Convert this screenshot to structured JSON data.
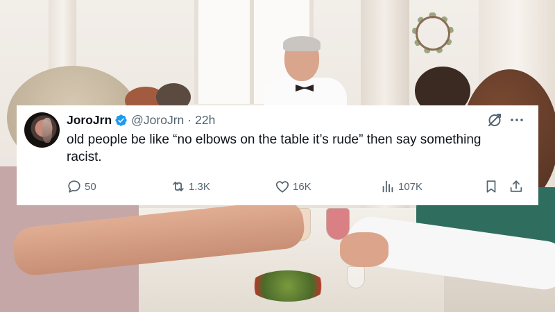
{
  "tweet": {
    "display_name": "JoroJrn",
    "handle": "@JoroJrn",
    "separator": "·",
    "time": "22h",
    "text": "old people be like “no elbows on the table it’s rude” then say something racist.",
    "verified": true,
    "actions": {
      "replies": "50",
      "retweets": "1.3K",
      "likes": "16K",
      "views": "107K"
    },
    "icons": {
      "verified": "verified-badge-icon",
      "grok": "grok-icon",
      "more": "more-icon",
      "reply": "reply-icon",
      "retweet": "retweet-icon",
      "like": "heart-icon",
      "views": "views-icon",
      "bookmark": "bookmark-icon",
      "share": "share-icon"
    },
    "colors": {
      "verified": "#1d9bf0",
      "text": "#0f1419",
      "secondary": "#536471"
    }
  }
}
